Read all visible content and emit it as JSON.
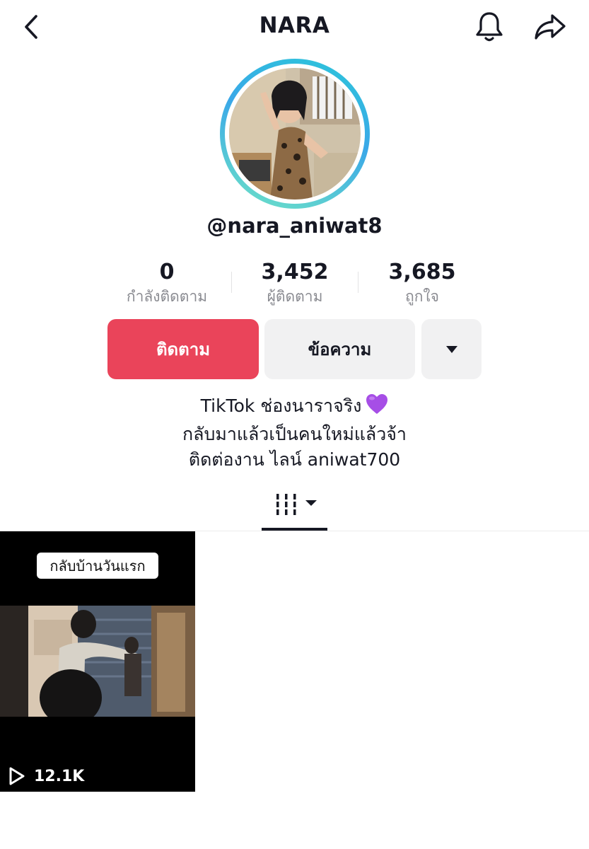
{
  "header": {
    "title": "NARA"
  },
  "profile": {
    "username": "@nara_aniwat8"
  },
  "stats": [
    {
      "value": "0",
      "label": "กำลังติดตาม"
    },
    {
      "value": "3,452",
      "label": "ผู้ติดตาม"
    },
    {
      "value": "3,685",
      "label": "ถูกใจ"
    }
  ],
  "actions": {
    "follow_label": "ติดตาม",
    "message_label": "ข้อความ",
    "more_icon": "caret-down-icon"
  },
  "bio": {
    "line1": "TikTok ช่องนาราจริง",
    "line1_emoji": "purple-heart",
    "line2": "กลับมาแล้วเป็นคนใหม่แล้วจ้า",
    "line3": "ติดต่องาน ไลน์ aniwat700"
  },
  "tabs": {
    "active": "videos-grid-icon"
  },
  "videos": [
    {
      "caption": "กลับบ้านวันแรก",
      "views": "12.1K"
    }
  ],
  "colors": {
    "follow": "#ea445a",
    "secondary_button": "#f1f1f2",
    "heart": "#a64ee6"
  }
}
